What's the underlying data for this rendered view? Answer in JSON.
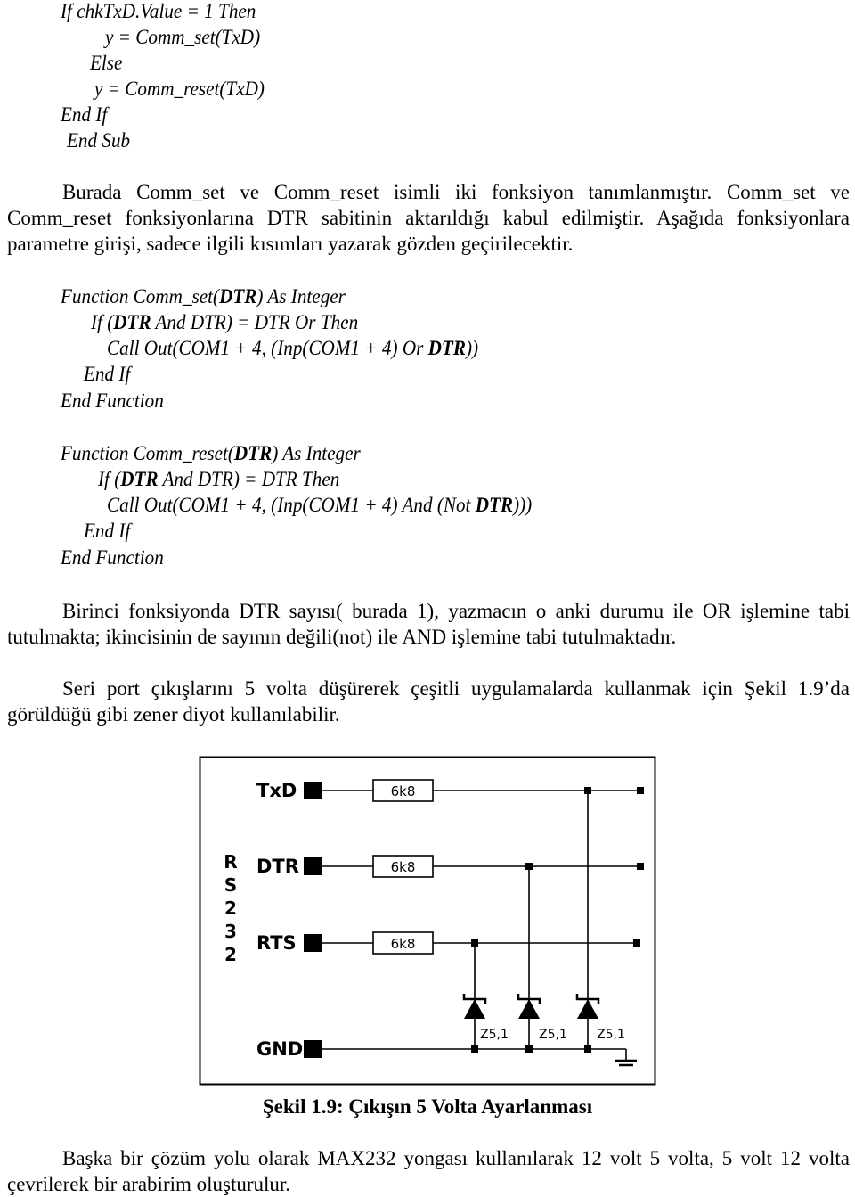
{
  "code_block_1": {
    "lines": [
      "If chkTxD.Value = 1 Then",
      "y = Comm_set(TxD)",
      "Else",
      "y = Comm_reset(TxD)",
      "End If",
      "End Sub"
    ]
  },
  "paragraph_1": "Burada Comm_set ve Comm_reset  isimli iki fonksiyon tanımlanmıştır.  Comm_set ve Comm_reset fonksiyonlarına DTR sabitinin aktarıldığı kabul edilmiştir. Aşağıda fonksiyonlara parametre girişi, sadece ilgili kısımları yazarak gözden geçirilecektir.",
  "code_block_2": {
    "l1_a": "Function Comm_set(",
    "l1_b": "DTR",
    "l1_c": ") As Integer",
    "l2_a": "If (",
    "l2_b": "DTR",
    "l2_c": " And DTR) = DTR Or Then",
    "l3_a": "Call Out(COM1 + 4, (Inp(COM1 + 4) Or ",
    "l3_b": "DTR",
    "l3_c": "))",
    "l4": "End If",
    "l5": "End Function"
  },
  "code_block_3": {
    "l1_a": "Function Comm_reset(",
    "l1_b": "DTR",
    "l1_c": ") As Integer",
    "l2_a": "If (",
    "l2_b": "DTR",
    "l2_c": " And DTR) = DTR Then",
    "l3_a": "Call Out(COM1 + 4, (Inp(COM1 + 4) And (Not ",
    "l3_b": "DTR",
    "l3_c": ")))",
    "l4": "End If",
    "l5": "End Function"
  },
  "paragraph_2": "Birinci fonksiyonda DTR sayısı( burada 1), yazmacın o anki durumu ile OR işlemine tabi tutulmakta; ikincisinin de sayının değili(not) ile AND işlemine tabi tutulmaktadır.",
  "paragraph_3": "Seri port çıkışlarını 5 volta düşürerek çeşitli uygulamalarda kullanmak için Şekil 1.9’da görüldüğü gibi zener diyot kullanılabilir.",
  "figure": {
    "port_label": [
      "R",
      "S",
      "2",
      "3",
      "2"
    ],
    "pins": [
      "TxD",
      "DTR",
      "RTS",
      "GND"
    ],
    "resistor_label": "6k8",
    "zener_label": "Z5,1",
    "caption": "Şekil 1.9: Çıkışın 5 Volta Ayarlanması"
  },
  "paragraph_4": "Başka bir çözüm yolu olarak MAX232 yongası kullanılarak 12 volt 5 volta, 5 volt 12 volta çevrilerek bir arabirim oluşturulur."
}
